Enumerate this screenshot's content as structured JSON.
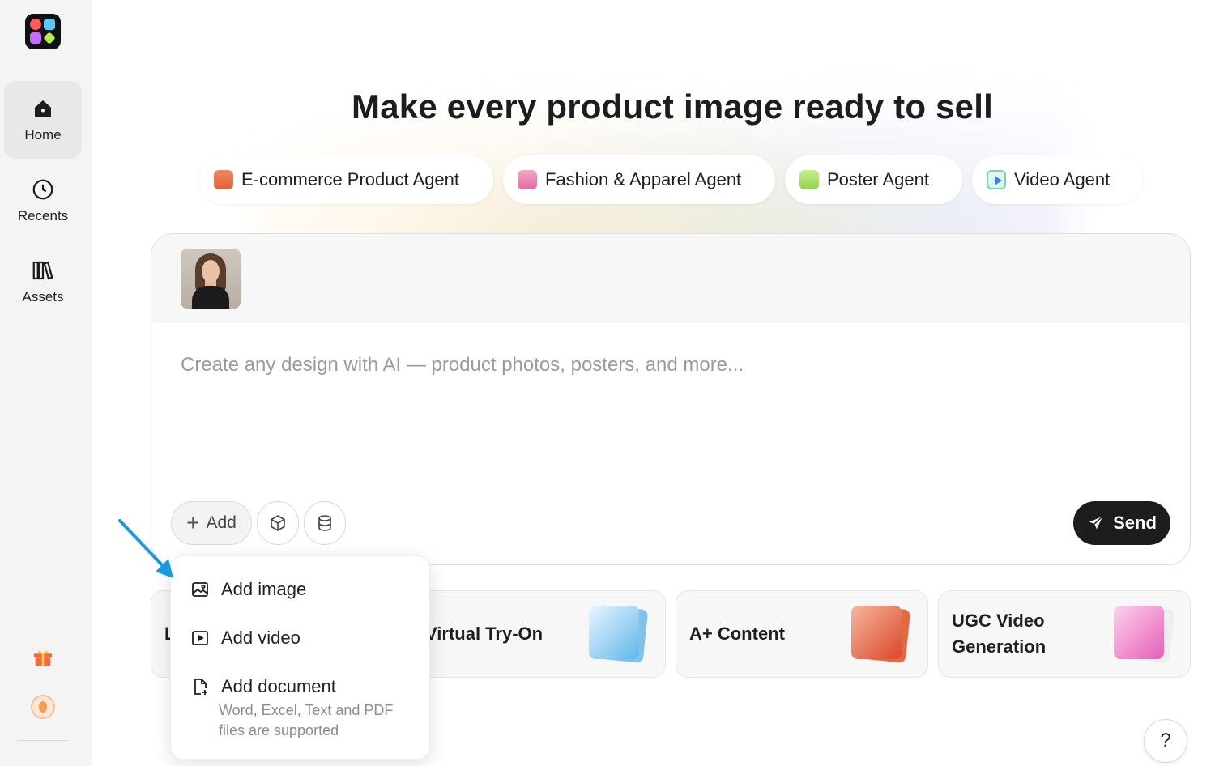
{
  "sidebar": {
    "items": [
      {
        "label": "Home",
        "icon": "home-icon",
        "active": true
      },
      {
        "label": "Recents",
        "icon": "clock-icon",
        "active": false
      },
      {
        "label": "Assets",
        "icon": "library-icon",
        "active": false
      }
    ]
  },
  "hero": {
    "title": "Make every product image ready to sell"
  },
  "agents": [
    {
      "label": "E-commerce Product Agent",
      "icon": "sofa-icon"
    },
    {
      "label": "Fashion & Apparel Agent",
      "icon": "shirt-icon"
    },
    {
      "label": "Poster Agent",
      "icon": "poster-icon"
    },
    {
      "label": "Video Agent",
      "icon": "video-play-icon"
    }
  ],
  "composer": {
    "placeholder": "Create any design with AI — product photos, posters, and more...",
    "add_label": "Add",
    "send_label": "Send"
  },
  "features": [
    {
      "label": "L"
    },
    {
      "label": "Virtual Try-On"
    },
    {
      "label": "A+ Content"
    },
    {
      "label": "UGC Video Generation"
    }
  ],
  "add_menu": {
    "items": [
      {
        "label": "Add image",
        "icon": "image-icon"
      },
      {
        "label": "Add video",
        "icon": "video-icon"
      },
      {
        "label": "Add document",
        "icon": "document-icon"
      }
    ],
    "document_hint": "Word, Excel, Text and PDF files are supported"
  },
  "help_label": "?",
  "colors": {
    "accent_dark": "#1d1d1f",
    "sidebar_bg": "#f4f4f5",
    "arrow": "#1a9be0"
  }
}
